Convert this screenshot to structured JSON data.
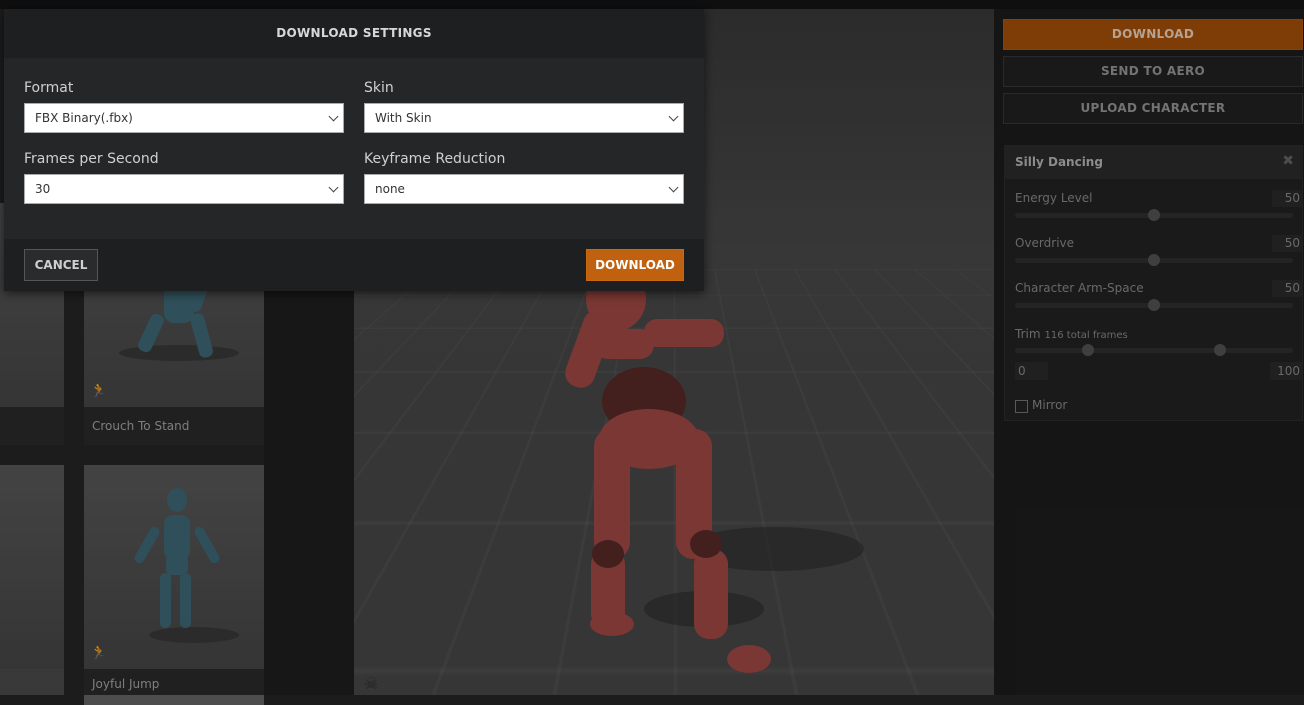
{
  "modal": {
    "title": "DOWNLOAD SETTINGS",
    "format_label": "Format",
    "format_value": "FBX Binary(.fbx)",
    "skin_label": "Skin",
    "skin_value": "With Skin",
    "fps_label": "Frames per Second",
    "fps_value": "30",
    "keyframe_label": "Keyframe Reduction",
    "keyframe_value": "none",
    "cancel_label": "CANCEL",
    "download_label": "DOWNLOAD"
  },
  "sidebar": {
    "download_label": "DOWNLOAD",
    "send_label": "SEND TO AERO",
    "upload_label": "UPLOAD CHARACTER"
  },
  "animation": {
    "title": "Silly Dancing",
    "params": [
      {
        "label": "Energy Level",
        "value": "50",
        "level": 0.5
      },
      {
        "label": "Overdrive",
        "value": "50",
        "level": 0.5
      },
      {
        "label": "Character Arm-Space",
        "value": "50",
        "level": 0.5
      }
    ],
    "trim": {
      "label": "Trim",
      "frames_note": "116 total frames",
      "start": "0",
      "end": "100",
      "start_level": 0.26,
      "end_level": 0.74
    },
    "mirror_label": "Mirror"
  },
  "library": {
    "items": [
      {
        "caption": "Crouch To Stand"
      },
      {
        "caption": "Joyful Jump"
      }
    ]
  },
  "colors": {
    "accent": "#c0610f",
    "character": "#a44a44",
    "thumb_character": "#3f6a78"
  }
}
